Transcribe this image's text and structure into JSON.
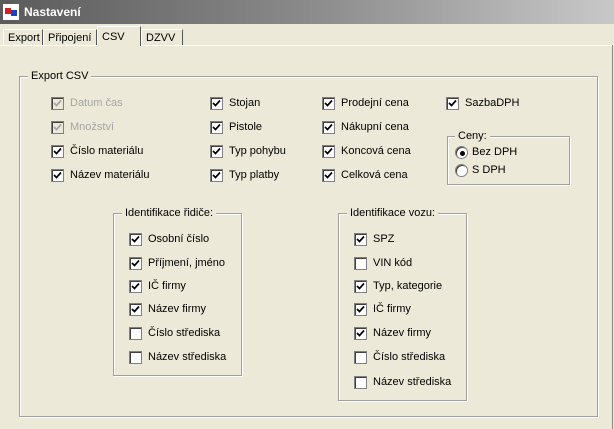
{
  "window": {
    "title": "Nastavení"
  },
  "tabs": [
    {
      "label": "Export",
      "active": false
    },
    {
      "label": "Připojení",
      "active": false
    },
    {
      "label": "CSV",
      "active": true
    },
    {
      "label": "DZVV",
      "active": false
    }
  ],
  "export_csv": {
    "legend": "Export CSV",
    "col1": [
      {
        "label": "Datum čas",
        "checked": true,
        "enabled": false
      },
      {
        "label": "Množství",
        "checked": true,
        "enabled": false
      },
      {
        "label": "Číslo materiálu",
        "checked": true,
        "enabled": true
      },
      {
        "label": "Název materiálu",
        "checked": true,
        "enabled": true
      }
    ],
    "col2": [
      {
        "label": "Stojan",
        "checked": true,
        "enabled": true
      },
      {
        "label": "Pistole",
        "checked": true,
        "enabled": true
      },
      {
        "label": "Typ pohybu",
        "checked": true,
        "enabled": true
      },
      {
        "label": "Typ platby",
        "checked": true,
        "enabled": true
      }
    ],
    "col3": [
      {
        "label": "Prodejní cena",
        "checked": true,
        "enabled": true
      },
      {
        "label": "Nákupní cena",
        "checked": true,
        "enabled": true
      },
      {
        "label": "Koncová cena",
        "checked": true,
        "enabled": true
      },
      {
        "label": "Celková cena",
        "checked": true,
        "enabled": true
      }
    ],
    "sazba": {
      "label": "SazbaDPH",
      "checked": true,
      "enabled": true
    },
    "ceny": {
      "legend": "Ceny:",
      "options": [
        {
          "label": "Bez DPH",
          "selected": true
        },
        {
          "label": "S DPH",
          "selected": false
        }
      ]
    },
    "driver": {
      "legend": "Identifikace řidiče:",
      "items": [
        {
          "label": "Osobní číslo",
          "checked": true
        },
        {
          "label": "Příjmení, jméno",
          "checked": true
        },
        {
          "label": "IČ firmy",
          "checked": true
        },
        {
          "label": "Název firmy",
          "checked": true
        },
        {
          "label": "Číslo střediska",
          "checked": false
        },
        {
          "label": "Název střediska",
          "checked": false
        }
      ]
    },
    "vehicle": {
      "legend": "Identifikace vozu:",
      "items": [
        {
          "label": "SPZ",
          "checked": true
        },
        {
          "label": "VIN kód",
          "checked": false
        },
        {
          "label": "Typ, kategorie",
          "checked": true
        },
        {
          "label": "IČ firmy",
          "checked": true
        },
        {
          "label": "Název firmy",
          "checked": true
        },
        {
          "label": "Číslo střediska",
          "checked": false
        },
        {
          "label": "Název střediska",
          "checked": false
        }
      ]
    }
  }
}
